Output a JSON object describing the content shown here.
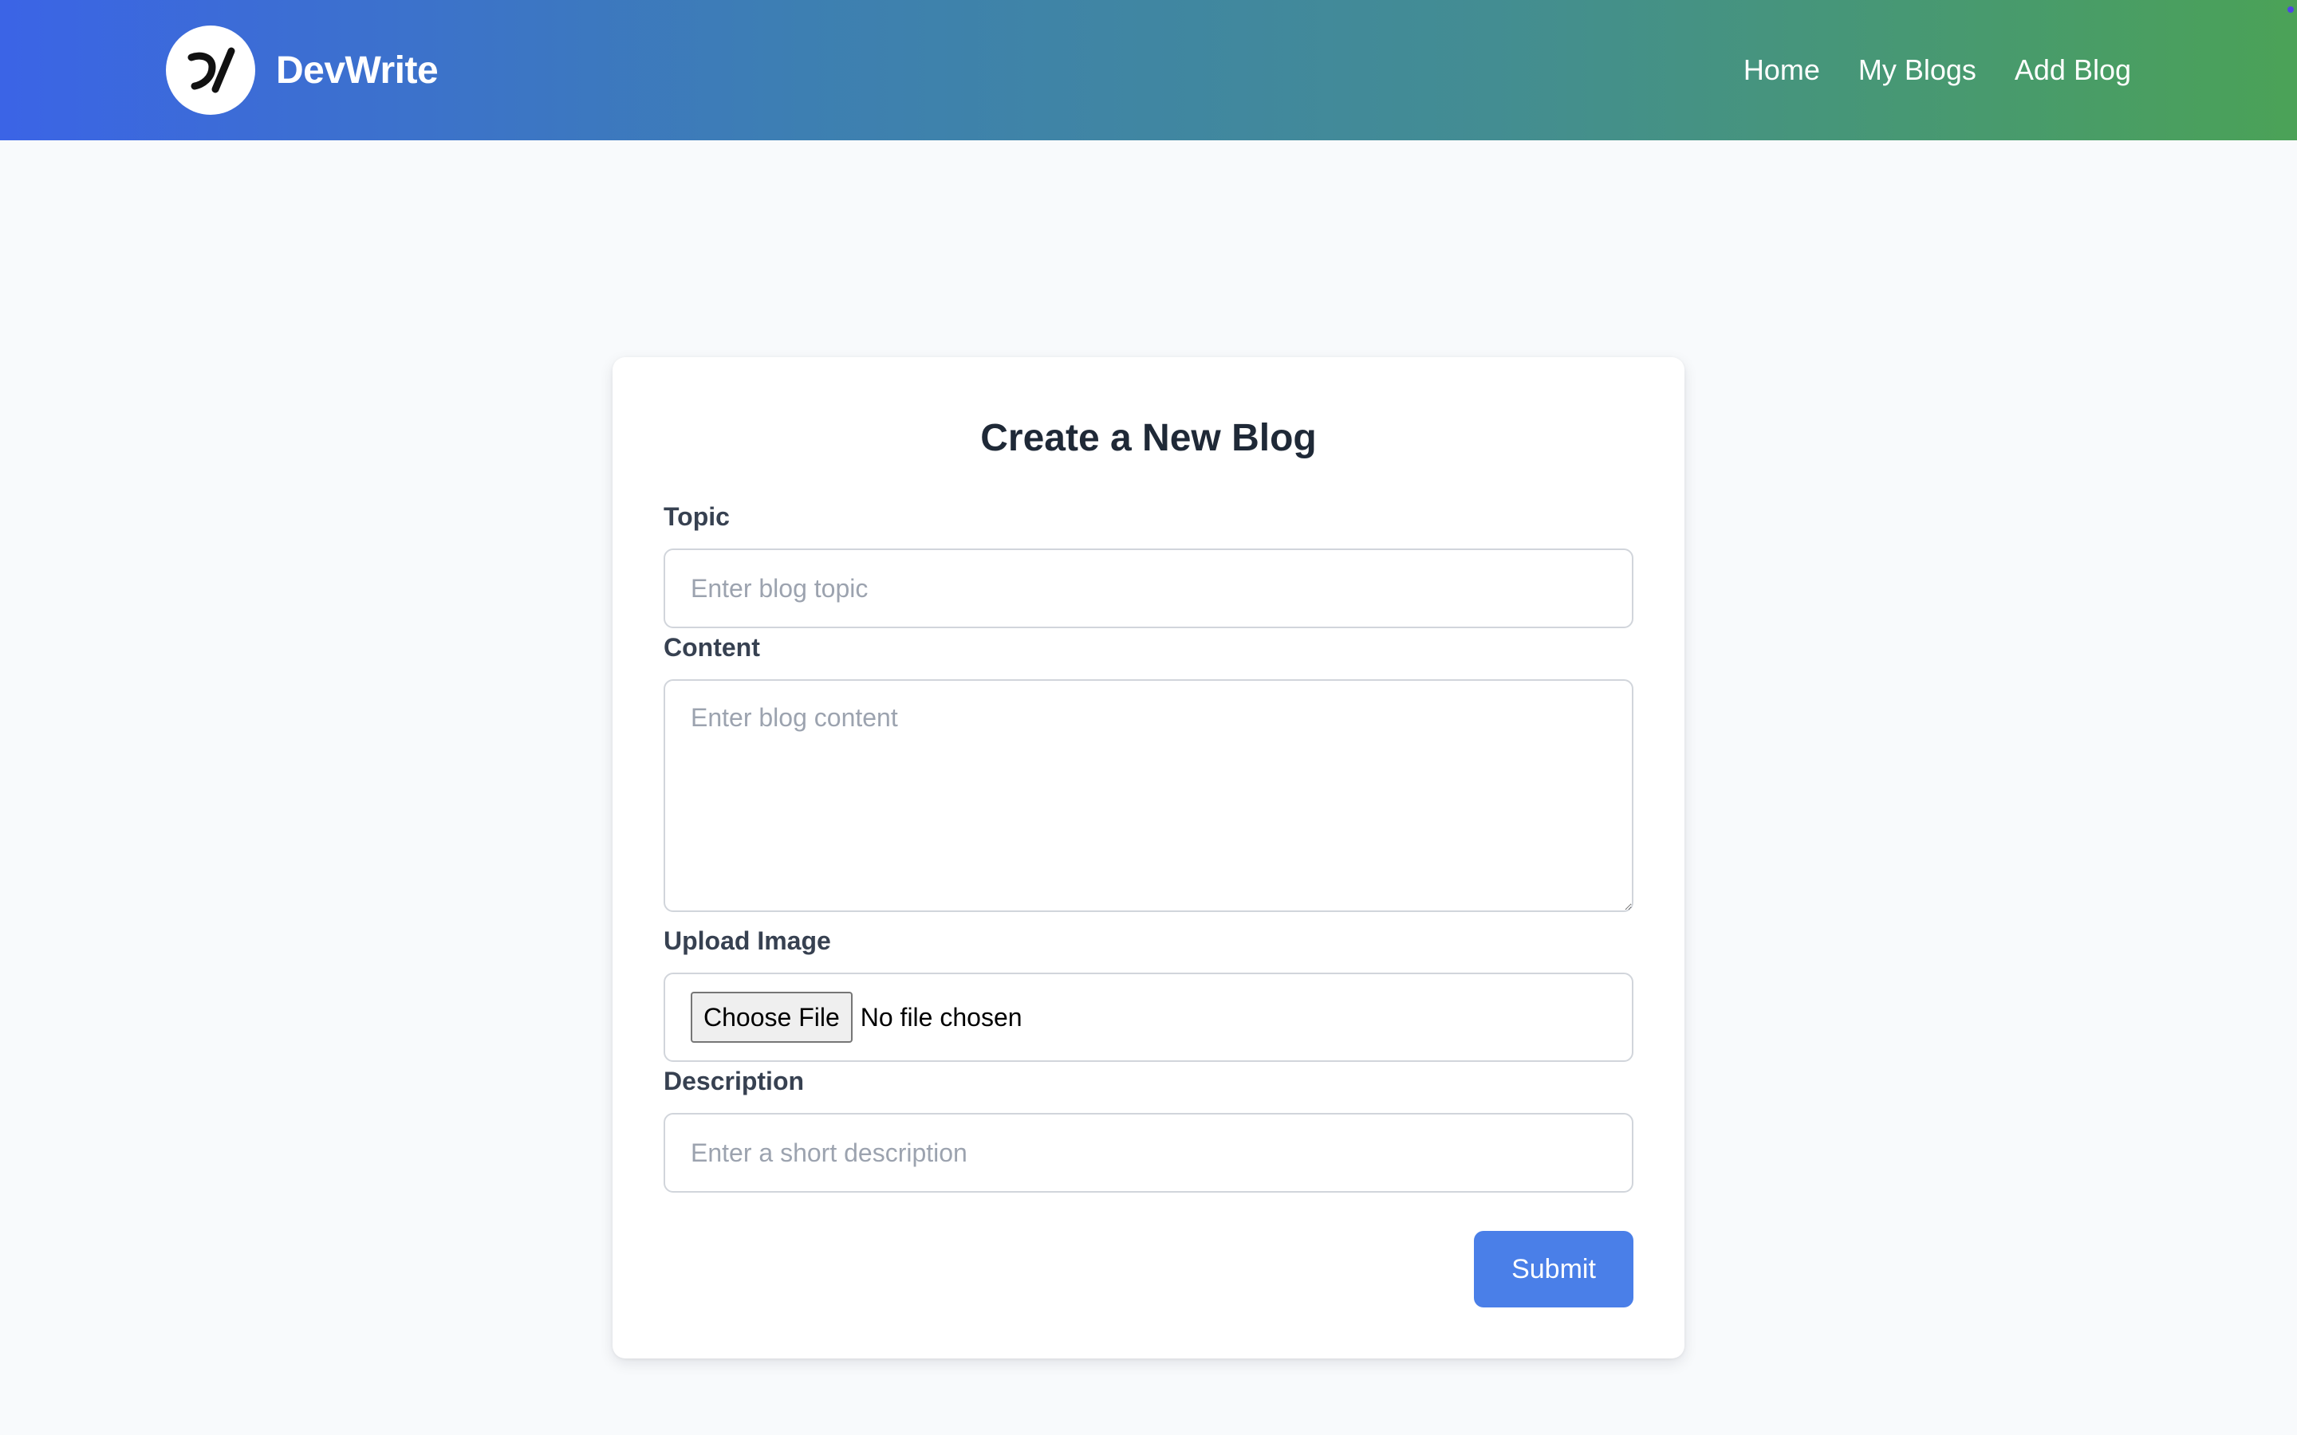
{
  "brand": {
    "name": "DevWrite",
    "logo_icon": "devwrite-logo-icon"
  },
  "nav": {
    "items": [
      {
        "label": "Home"
      },
      {
        "label": "My Blogs"
      },
      {
        "label": "Add Blog"
      }
    ]
  },
  "form": {
    "title": "Create a New Blog",
    "topic": {
      "label": "Topic",
      "placeholder": "Enter blog topic",
      "value": ""
    },
    "content": {
      "label": "Content",
      "placeholder": "Enter blog content",
      "value": ""
    },
    "image": {
      "label": "Upload Image",
      "button_label": "Choose File",
      "status": "No file chosen"
    },
    "description": {
      "label": "Description",
      "placeholder": "Enter a short description",
      "value": ""
    },
    "submit_label": "Submit"
  },
  "colors": {
    "header_gradient_start": "#3b64e6",
    "header_gradient_end": "#4ba257",
    "submit_button": "#4a7fe8",
    "page_background": "#f8fafc"
  }
}
